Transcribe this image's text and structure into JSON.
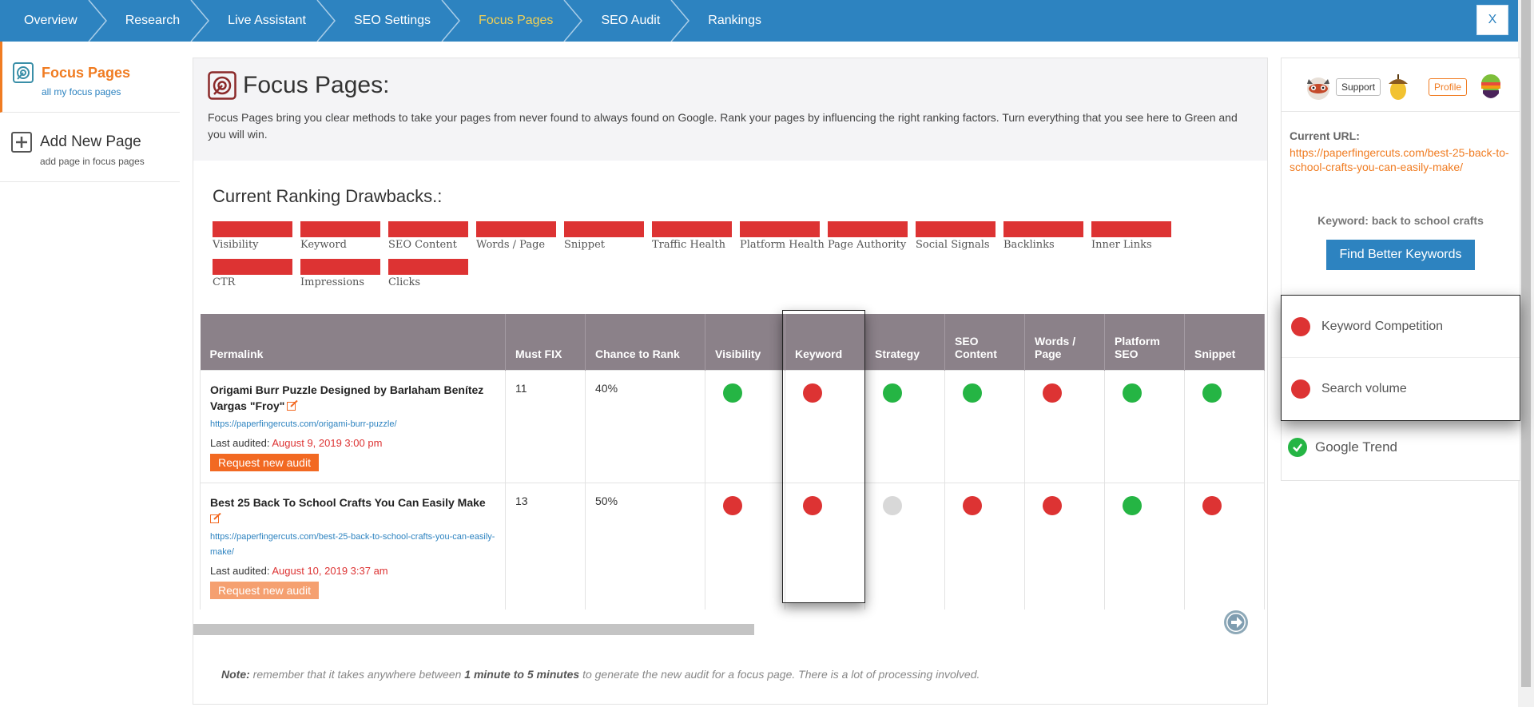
{
  "nav": {
    "crumbs": [
      "Overview",
      "Research",
      "Live Assistant",
      "SEO Settings",
      "Focus Pages",
      "SEO Audit",
      "Rankings"
    ],
    "active_index": 4,
    "close_label": "X",
    "bar_color": "#2d83c0",
    "active_color": "#f2d054"
  },
  "sidebar": {
    "items": [
      {
        "title": "Focus Pages",
        "subtitle": "all my focus pages",
        "icon": "focus-target-icon"
      },
      {
        "title": "Add New Page",
        "subtitle": "add page in focus pages",
        "icon": "plus-square-icon"
      }
    ]
  },
  "header": {
    "title": "Focus Pages:",
    "description": "Focus Pages bring you clear methods to take your pages from never found to always found on Google. Rank your pages by influencing the right ranking factors. Turn everything that you see here to Green and you will win."
  },
  "drawbacks": {
    "title": "Current Ranking Drawbacks.:",
    "items": [
      "Visibility",
      "Keyword",
      "SEO Content",
      "Words / Page",
      "Snippet",
      "Traffic Health",
      "Platform Health",
      "Page Authority",
      "Social Signals",
      "Backlinks",
      "Inner Links",
      "CTR",
      "Impressions",
      "Clicks"
    ],
    "color": "#dd3333"
  },
  "table": {
    "headers": [
      "Permalink",
      "Must FIX",
      "Chance to Rank",
      "Visibility",
      "Keyword",
      "Strategy",
      "SEO Content",
      "Words / Page",
      "Platform SEO",
      "Snippet"
    ],
    "rows": [
      {
        "title": "Origami Burr Puzzle Designed by Barlaham Benítez Vargas \"Froy\"",
        "url": "https://paperfingercuts.com/origami-burr-puzzle/",
        "audited_label": "Last audited:",
        "audited_date": "August 9, 2019 3:00 pm",
        "button": "Request new audit",
        "must_fix": "11",
        "chance": "40%",
        "statuses": [
          "green",
          "red",
          "green",
          "green",
          "red",
          "green",
          "green"
        ]
      },
      {
        "title": "Best 25 Back To School Crafts You Can Easily Make",
        "url": "https://paperfingercuts.com/best-25-back-to-school-crafts-you-can-easily-make/",
        "audited_label": "Last audited:",
        "audited_date": "August 10, 2019 3:37 am",
        "button": "Request new audit",
        "must_fix": "13",
        "chance": "50%",
        "statuses": [
          "red",
          "red",
          "grey",
          "red",
          "red",
          "green",
          "red"
        ]
      }
    ]
  },
  "note": {
    "prefix": "Note:",
    "part1": "remember that it takes anywhere between",
    "bold": "1 minute to 5 minutes",
    "part2": "to generate the new audit for a focus page. There is a lot of processing involved."
  },
  "right_panel": {
    "support_label": "Support",
    "profile_label": "Profile",
    "url_label": "Current URL:",
    "url": "https://paperfingercuts.com/best-25-back-to-school-crafts-you-can-easily-make/",
    "keyword_label": "Keyword: back to school crafts",
    "find_button": "Find Better Keywords",
    "checks": [
      {
        "label": "Keyword Competition",
        "status": "red"
      },
      {
        "label": "Search volume",
        "status": "red"
      }
    ],
    "trend_label": "Google Trend",
    "trend_status": "green"
  }
}
